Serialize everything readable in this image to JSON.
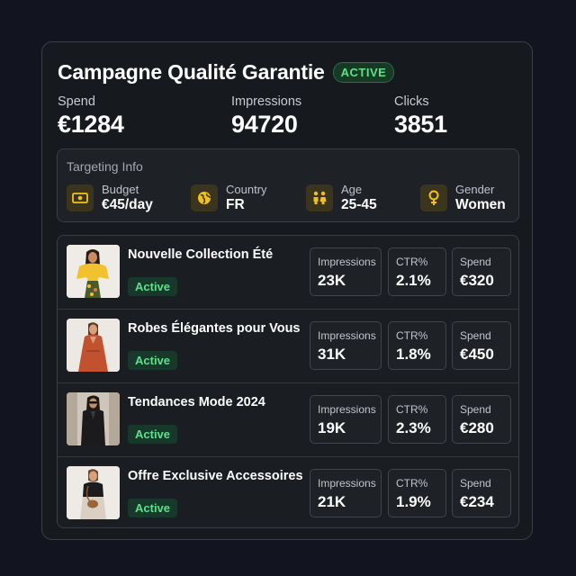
{
  "campaign": {
    "title": "Campagne Qualité Garantie",
    "status": "ACTIVE"
  },
  "stats": [
    {
      "label": "Spend",
      "value": "€1284"
    },
    {
      "label": "Impressions",
      "value": "94720"
    },
    {
      "label": "Clicks",
      "value": "3851"
    }
  ],
  "targeting": {
    "title": "Targeting Info",
    "items": [
      {
        "label": "Budget",
        "value": "€45/day",
        "icon": "money-icon"
      },
      {
        "label": "Country",
        "value": "FR",
        "icon": "globe-icon"
      },
      {
        "label": "Age",
        "value": "25-45",
        "icon": "people-icon"
      },
      {
        "label": "Gender",
        "value": "Women",
        "icon": "female-icon"
      }
    ]
  },
  "ads": [
    {
      "name": "Nouvelle Collection Été",
      "status": "Active",
      "impressions": "23K",
      "ctr": "2.1%",
      "spend": "€320"
    },
    {
      "name": "Robes Élégantes pour Vous",
      "status": "Active",
      "impressions": "31K",
      "ctr": "1.8%",
      "spend": "€450"
    },
    {
      "name": "Tendances Mode 2024",
      "status": "Active",
      "impressions": "19K",
      "ctr": "2.3%",
      "spend": "€280"
    },
    {
      "name": "Offre Exclusive Accessoires",
      "status": "Active",
      "impressions": "21K",
      "ctr": "1.9%",
      "spend": "€234"
    }
  ],
  "metric_labels": {
    "impressions": "Impressions",
    "ctr": "CTR%",
    "spend": "Spend"
  },
  "colors": {
    "background": "#12151f",
    "card": "#16191e",
    "accent_green": "#5fe08a",
    "icon_yellow": "#f1c21b"
  }
}
